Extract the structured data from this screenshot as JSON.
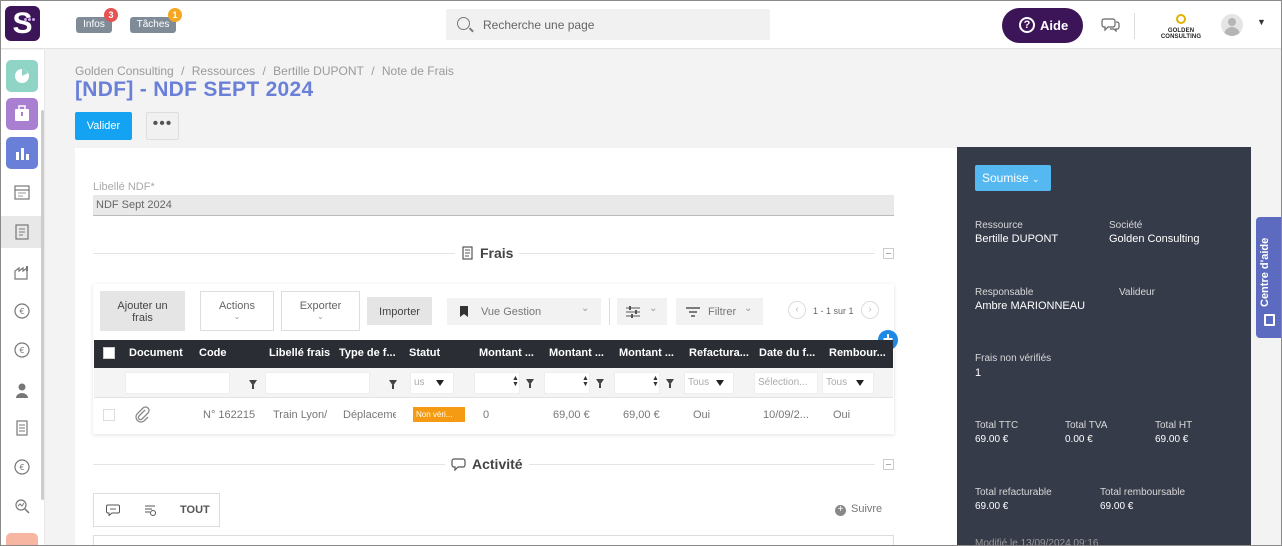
{
  "topbar": {
    "logo": "S",
    "infos_label": "Infos",
    "infos_count": "3",
    "taches_label": "Tâches",
    "taches_count": "1",
    "search_placeholder": "Recherche une page",
    "aide_label": "Aide",
    "company_logo_text": "GOLDEN CONSULTING",
    "badge_colors": {
      "infos": "#e55353",
      "taches": "#f5a623"
    }
  },
  "rail": {
    "items": [
      "dashboard-icon",
      "briefcase-icon",
      "chart-icon",
      "calendar-icon",
      "document-icon",
      "factory-icon",
      "euro-in-icon",
      "euro-out-icon",
      "person-icon",
      "invoice-icon",
      "euro-refund-icon",
      "search-analytics-icon",
      "settings-icon"
    ]
  },
  "breadcrumb": [
    "Golden Consulting",
    "/",
    "Ressources",
    "/",
    "Bertille DUPONT",
    "/",
    "Note de Frais"
  ],
  "page": {
    "title": "[NDF] - NDF SEPT 2024",
    "valider_label": "Valider",
    "more_label": "•••"
  },
  "form": {
    "libelle_label": "Libellé NDF*",
    "libelle_value": "NDF Sept 2024"
  },
  "frais": {
    "section_title": "Frais",
    "toolbar": {
      "ajouter_label": "Ajouter un frais",
      "actions_label": "Actions",
      "exporter_label": "Exporter",
      "importer_label": "Importer",
      "vue_label": "Vue Gestion",
      "filtrer_label": "Filtrer",
      "pager_text": "1 - 1 sur 1"
    },
    "columns": [
      "Document",
      "Code",
      "Libellé frais",
      "Type de f...",
      "Statut",
      "Montant ...",
      "Montant ...",
      "Montant ...",
      "Refactura...",
      "Date du f...",
      "Rembour..."
    ],
    "filters": {
      "statut": "us",
      "refacturable": "Tous",
      "date": "Sélection...",
      "remboursable": "Tous"
    },
    "rows": [
      {
        "code": "N° 162215",
        "libelle": "Train Lyon/",
        "type": "Déplaceme",
        "statut": "Non véri...",
        "montant1": "0",
        "montant2": "69,00 €",
        "montant3": "69,00 €",
        "refacturable": "Oui",
        "date": "10/09/2...",
        "remboursable": "Oui"
      }
    ],
    "status_color": "#f59a13"
  },
  "activite": {
    "section_title": "Activité",
    "tab_all": "TOUT",
    "suivre_label": "Suivre"
  },
  "panel": {
    "status_label": "Soumise",
    "ressource_label": "Ressource",
    "ressource_value": "Bertille DUPONT",
    "societe_label": "Société",
    "societe_value": "Golden Consulting",
    "responsable_label": "Responsable",
    "responsable_value": "Ambre MARIONNEAU",
    "valideur_label": "Valideur",
    "frais_nv_label": "Frais non vérifiés",
    "frais_nv_value": "1",
    "ttc_label": "Total TTC",
    "ttc_value": "69.00 €",
    "tva_label": "Total TVA",
    "tva_value": "0.00 €",
    "ht_label": "Total HT",
    "ht_value": "69.00 €",
    "refact_label": "Total refacturable",
    "refact_value": "69.00 €",
    "rembours_label": "Total remboursable",
    "rembours_value": "69.00 €",
    "modified_label": "Modifié le",
    "modified_value": "13/09/2024 09:16",
    "bg_color": "#363b4a"
  },
  "help_tab": {
    "label": "Centre d'aide"
  }
}
